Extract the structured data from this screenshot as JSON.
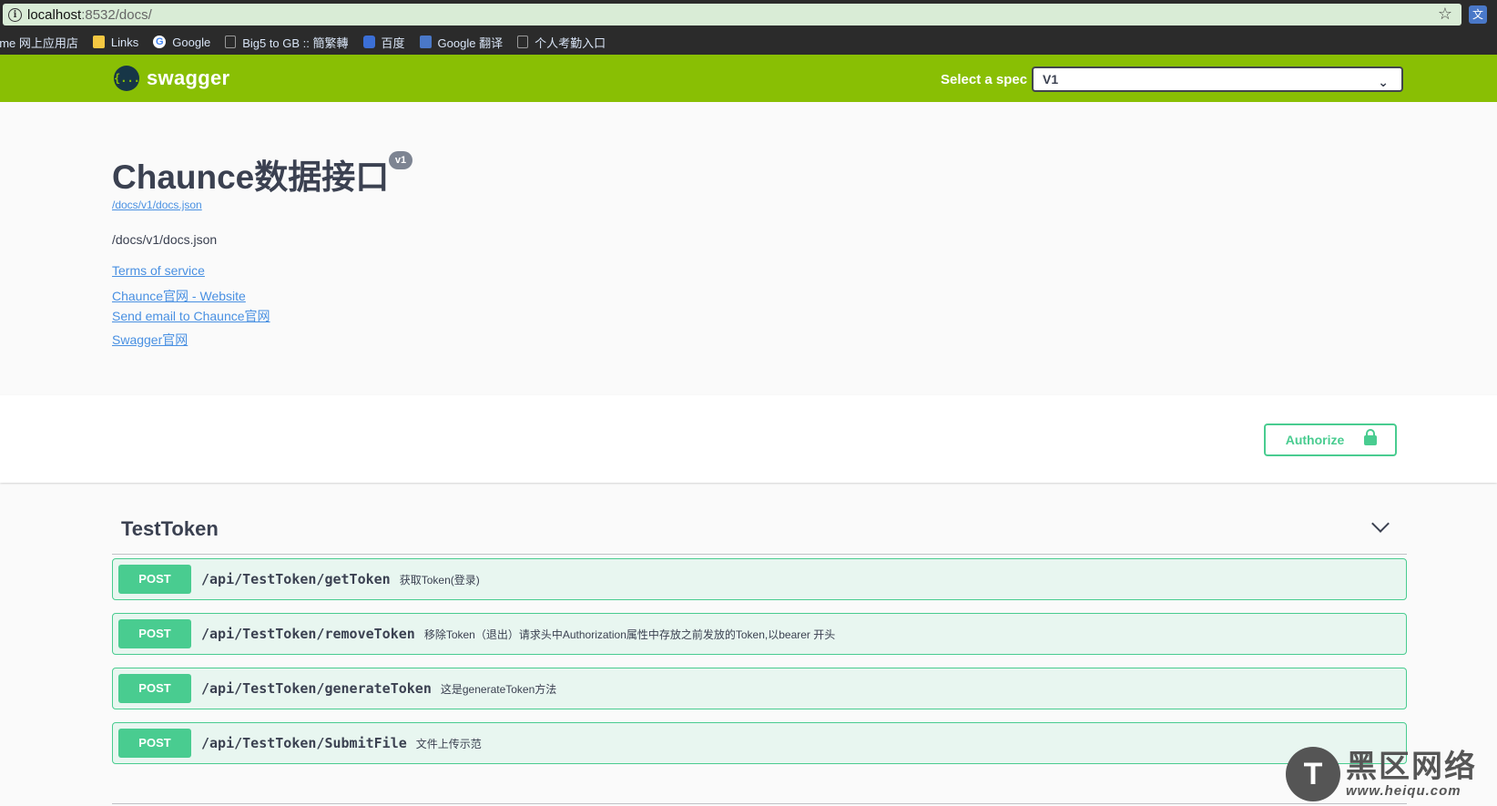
{
  "browser": {
    "url_host": "localhost",
    "url_rest": ":8532/docs/",
    "bookmarks": [
      {
        "label": "ome 网上应用店",
        "icon": "none"
      },
      {
        "label": "Links",
        "icon": "folder-icon"
      },
      {
        "label": "Google",
        "icon": "google-icon"
      },
      {
        "label": "Big5 to GB :: 簡繁轉",
        "icon": "page-icon"
      },
      {
        "label": "百度",
        "icon": "baidu-icon"
      },
      {
        "label": "Google 翻译",
        "icon": "translate-icon"
      },
      {
        "label": "个人考勤入口",
        "icon": "page-icon"
      }
    ]
  },
  "topbar": {
    "logo_text": "swagger",
    "logo_glyph": "{...}",
    "spec_label": "Select a spec",
    "spec_value": "V1"
  },
  "info": {
    "title": "Chaunce数据接口",
    "version": "v1",
    "spec_url": "/docs/v1/docs.json",
    "description": "/docs/v1/docs.json",
    "links": [
      "Terms of service",
      "Chaunce官网 - Website",
      "Send email to Chaunce官网",
      "Swagger官网"
    ]
  },
  "auth": {
    "label": "Authorize"
  },
  "tag": {
    "name": "TestToken",
    "operations": [
      {
        "method": "POST",
        "path": "/api/TestToken/getToken",
        "summary": "获取Token(登录)"
      },
      {
        "method": "POST",
        "path": "/api/TestToken/removeToken",
        "summary": "移除Token（退出）请求头中Authorization属性中存放之前发放的Token,以bearer 开头"
      },
      {
        "method": "POST",
        "path": "/api/TestToken/generateToken",
        "summary": "这是generateToken方法"
      },
      {
        "method": "POST",
        "path": "/api/TestToken/SubmitFile",
        "summary": "文件上传示范"
      }
    ]
  },
  "watermark": {
    "cn": "黑区网络",
    "url": "www.heiqu.com"
  },
  "colors": {
    "topbar": "#89bf04",
    "post": "#49cc90",
    "post_bg": "#e8f6f0",
    "link": "#4990e2",
    "text": "#3b4151"
  }
}
